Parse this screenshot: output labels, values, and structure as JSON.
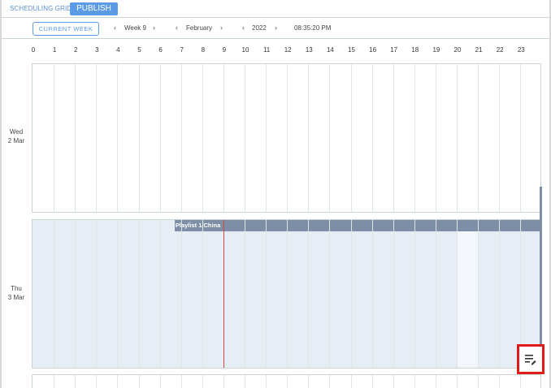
{
  "header": {
    "title": "SCHEDULING GRID",
    "publish_label": "PUBLISH"
  },
  "nav": {
    "current_week_label": "CURRENT WEEK",
    "week": "Week 9",
    "month": "February",
    "year": "2022",
    "time": "08:35:20 PM"
  },
  "hours": [
    "0",
    "1",
    "2",
    "3",
    "4",
    "5",
    "6",
    "7",
    "8",
    "9",
    "10",
    "11",
    "12",
    "13",
    "14",
    "15",
    "16",
    "17",
    "18",
    "19",
    "20",
    "21",
    "22",
    "23"
  ],
  "days": [
    {
      "weekday": "Wed",
      "date": "2 Mar"
    },
    {
      "weekday": "Thu",
      "date": "3 Mar"
    }
  ],
  "events": [
    {
      "label": "Playlist 1/China",
      "start_hour": 6.7
    }
  ],
  "now_hour": 9.0,
  "icons": {
    "chevron_left": "chevron-left-icon",
    "chevron_right": "chevron-right-icon",
    "edit": "edit-list-icon"
  },
  "colors": {
    "accent": "#5b9be6",
    "event_bar": "#7d8fa6",
    "now_line": "#d64545",
    "highlight": "#e01b1b"
  }
}
